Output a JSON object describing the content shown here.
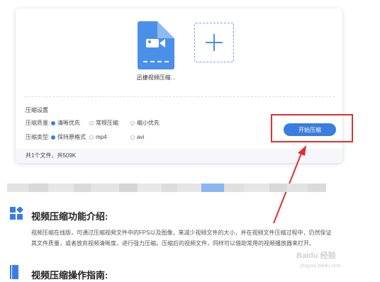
{
  "upload": {
    "file_name": "迅捷视频压缩...",
    "add_symbol": "+"
  },
  "settings": {
    "title": "压缩设置",
    "quality_label": "压缩质量:",
    "quality_options": [
      "清晰优先",
      "常规压缩",
      "缩小优先"
    ],
    "quality_selected": "清晰优先",
    "type_label": "压缩类型:",
    "type_options": [
      "保持原格式",
      "mp4",
      "avi"
    ],
    "type_selected": "保持原格式"
  },
  "start_button": "开始压缩",
  "footer": "共1个文件，共509K",
  "article": {
    "section1_title": "视频压缩功能介绍:",
    "section1_text": "视频压缩在线版，可通过压缩视频文件中的FPS以及图像，来减少视频文件的大小，并在视频文件压缩过程中，仍然保证其文件质量，或者放弃视频清晰度，进行强力压缩。压缩后的视频文件，同样可以借助常用的视频播放器来打开。",
    "section2_title": "视频压缩操作指南:"
  },
  "watermark": {
    "brand": "Baidu 经验",
    "url": "jingyan.baidu.com"
  },
  "colors": {
    "accent": "#3a7de0",
    "highlight": "#e03030",
    "file_icon": "#4a90e8"
  }
}
